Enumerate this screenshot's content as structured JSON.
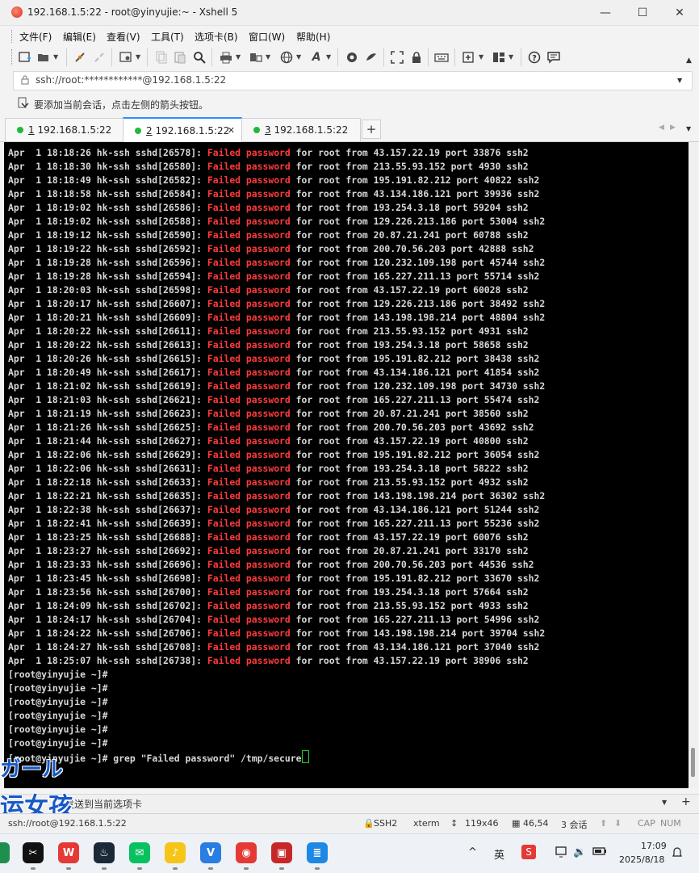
{
  "window": {
    "title": "192.168.1.5:22 - root@yinyujie:~ - Xshell 5",
    "minimize_glyph": "—",
    "maximize_glyph": "☐",
    "close_glyph": "✕"
  },
  "menu": [
    "文件(F)",
    "编辑(E)",
    "查看(V)",
    "工具(T)",
    "选项卡(B)",
    "窗口(W)",
    "帮助(H)"
  ],
  "address": {
    "value": "ssh://root:************@192.168.1.5:22"
  },
  "hint": {
    "text": "要添加当前会话，点击左侧的箭头按钮。"
  },
  "tabs": [
    {
      "num": "1",
      "label": " 192.168.1.5:22"
    },
    {
      "num": "2",
      "label": " 192.168.1.5:22"
    },
    {
      "num": "3",
      "label": " 192.168.1.5:22"
    }
  ],
  "tab_close_glyph": "✕",
  "tab_add_glyph": "+",
  "terminal": {
    "log": [
      {
        "prefix": "Apr  1 18:18:26 hk-ssh sshd[26578]: ",
        "failed": "Failed",
        "password": "password",
        "suffix": " for root from 43.157.22.19 port 33876 ssh2"
      },
      {
        "prefix": "Apr  1 18:18:30 hk-ssh sshd[26580]: ",
        "failed": "Failed",
        "password": "password",
        "suffix": " for root from 213.55.93.152 port 4930 ssh2"
      },
      {
        "prefix": "Apr  1 18:18:49 hk-ssh sshd[26582]: ",
        "failed": "Failed",
        "password": "password",
        "suffix": " for root from 195.191.82.212 port 40822 ssh2"
      },
      {
        "prefix": "Apr  1 18:18:58 hk-ssh sshd[26584]: ",
        "failed": "Failed",
        "password": "password",
        "suffix": " for root from 43.134.186.121 port 39936 ssh2"
      },
      {
        "prefix": "Apr  1 18:19:02 hk-ssh sshd[26586]: ",
        "failed": "Failed",
        "password": "password",
        "suffix": " for root from 193.254.3.18 port 59204 ssh2"
      },
      {
        "prefix": "Apr  1 18:19:02 hk-ssh sshd[26588]: ",
        "failed": "Failed",
        "password": "password",
        "suffix": " for root from 129.226.213.186 port 53004 ssh2"
      },
      {
        "prefix": "Apr  1 18:19:12 hk-ssh sshd[26590]: ",
        "failed": "Failed",
        "password": "password",
        "suffix": " for root from 20.87.21.241 port 60788 ssh2"
      },
      {
        "prefix": "Apr  1 18:19:22 hk-ssh sshd[26592]: ",
        "failed": "Failed",
        "password": "password",
        "suffix": " for root from 200.70.56.203 port 42888 ssh2"
      },
      {
        "prefix": "Apr  1 18:19:28 hk-ssh sshd[26596]: ",
        "failed": "Failed",
        "password": "password",
        "suffix": " for root from 120.232.109.198 port 45744 ssh2"
      },
      {
        "prefix": "Apr  1 18:19:28 hk-ssh sshd[26594]: ",
        "failed": "Failed",
        "password": "password",
        "suffix": " for root from 165.227.211.13 port 55714 ssh2"
      },
      {
        "prefix": "Apr  1 18:20:03 hk-ssh sshd[26598]: ",
        "failed": "Failed",
        "password": "password",
        "suffix": " for root from 43.157.22.19 port 60028 ssh2"
      },
      {
        "prefix": "Apr  1 18:20:17 hk-ssh sshd[26607]: ",
        "failed": "Failed",
        "password": "password",
        "suffix": " for root from 129.226.213.186 port 38492 ssh2"
      },
      {
        "prefix": "Apr  1 18:20:21 hk-ssh sshd[26609]: ",
        "failed": "Failed",
        "password": "password",
        "suffix": " for root from 143.198.198.214 port 48804 ssh2"
      },
      {
        "prefix": "Apr  1 18:20:22 hk-ssh sshd[26611]: ",
        "failed": "Failed",
        "password": "password",
        "suffix": " for root from 213.55.93.152 port 4931 ssh2"
      },
      {
        "prefix": "Apr  1 18:20:22 hk-ssh sshd[26613]: ",
        "failed": "Failed",
        "password": "password",
        "suffix": " for root from 193.254.3.18 port 58658 ssh2"
      },
      {
        "prefix": "Apr  1 18:20:26 hk-ssh sshd[26615]: ",
        "failed": "Failed",
        "password": "password",
        "suffix": " for root from 195.191.82.212 port 38438 ssh2"
      },
      {
        "prefix": "Apr  1 18:20:49 hk-ssh sshd[26617]: ",
        "failed": "Failed",
        "password": "password",
        "suffix": " for root from 43.134.186.121 port 41854 ssh2"
      },
      {
        "prefix": "Apr  1 18:21:02 hk-ssh sshd[26619]: ",
        "failed": "Failed",
        "password": "password",
        "suffix": " for root from 120.232.109.198 port 34730 ssh2"
      },
      {
        "prefix": "Apr  1 18:21:03 hk-ssh sshd[26621]: ",
        "failed": "Failed",
        "password": "password",
        "suffix": " for root from 165.227.211.13 port 55474 ssh2"
      },
      {
        "prefix": "Apr  1 18:21:19 hk-ssh sshd[26623]: ",
        "failed": "Failed",
        "password": "password",
        "suffix": " for root from 20.87.21.241 port 38560 ssh2"
      },
      {
        "prefix": "Apr  1 18:21:26 hk-ssh sshd[26625]: ",
        "failed": "Failed",
        "password": "password",
        "suffix": " for root from 200.70.56.203 port 43692 ssh2"
      },
      {
        "prefix": "Apr  1 18:21:44 hk-ssh sshd[26627]: ",
        "failed": "Failed",
        "password": "password",
        "suffix": " for root from 43.157.22.19 port 40800 ssh2"
      },
      {
        "prefix": "Apr  1 18:22:06 hk-ssh sshd[26629]: ",
        "failed": "Failed",
        "password": "password",
        "suffix": " for root from 195.191.82.212 port 36054 ssh2"
      },
      {
        "prefix": "Apr  1 18:22:06 hk-ssh sshd[26631]: ",
        "failed": "Failed",
        "password": "password",
        "suffix": " for root from 193.254.3.18 port 58222 ssh2"
      },
      {
        "prefix": "Apr  1 18:22:18 hk-ssh sshd[26633]: ",
        "failed": "Failed",
        "password": "password",
        "suffix": " for root from 213.55.93.152 port 4932 ssh2"
      },
      {
        "prefix": "Apr  1 18:22:21 hk-ssh sshd[26635]: ",
        "failed": "Failed",
        "password": "password",
        "suffix": " for root from 143.198.198.214 port 36302 ssh2"
      },
      {
        "prefix": "Apr  1 18:22:38 hk-ssh sshd[26637]: ",
        "failed": "Failed",
        "password": "password",
        "suffix": " for root from 43.134.186.121 port 51244 ssh2"
      },
      {
        "prefix": "Apr  1 18:22:41 hk-ssh sshd[26639]: ",
        "failed": "Failed",
        "password": "password",
        "suffix": " for root from 165.227.211.13 port 55236 ssh2"
      },
      {
        "prefix": "Apr  1 18:23:25 hk-ssh sshd[26688]: ",
        "failed": "Failed",
        "password": "password",
        "suffix": " for root from 43.157.22.19 port 60076 ssh2"
      },
      {
        "prefix": "Apr  1 18:23:27 hk-ssh sshd[26692]: ",
        "failed": "Failed",
        "password": "password",
        "suffix": " for root from 20.87.21.241 port 33170 ssh2"
      },
      {
        "prefix": "Apr  1 18:23:33 hk-ssh sshd[26696]: ",
        "failed": "Failed",
        "password": "password",
        "suffix": " for root from 200.70.56.203 port 44536 ssh2"
      },
      {
        "prefix": "Apr  1 18:23:45 hk-ssh sshd[26698]: ",
        "failed": "Failed",
        "password": "password",
        "suffix": " for root from 195.191.82.212 port 33670 ssh2"
      },
      {
        "prefix": "Apr  1 18:23:56 hk-ssh sshd[26700]: ",
        "failed": "Failed",
        "password": "password",
        "suffix": " for root from 193.254.3.18 port 57664 ssh2"
      },
      {
        "prefix": "Apr  1 18:24:09 hk-ssh sshd[26702]: ",
        "failed": "Failed",
        "password": "password",
        "suffix": " for root from 213.55.93.152 port 4933 ssh2"
      },
      {
        "prefix": "Apr  1 18:24:17 hk-ssh sshd[26704]: ",
        "failed": "Failed",
        "password": "password",
        "suffix": " for root from 165.227.211.13 port 54996 ssh2"
      },
      {
        "prefix": "Apr  1 18:24:22 hk-ssh sshd[26706]: ",
        "failed": "Failed",
        "password": "password",
        "suffix": " for root from 143.198.198.214 port 39704 ssh2"
      },
      {
        "prefix": "Apr  1 18:24:27 hk-ssh sshd[26708]: ",
        "failed": "Failed",
        "password": "password",
        "suffix": " for root from 43.134.186.121 port 37040 ssh2"
      },
      {
        "prefix": "Apr  1 18:25:07 hk-ssh sshd[26738]: ",
        "failed": "Failed",
        "password": "password",
        "suffix": " for root from 43.157.22.19 port 38906 ssh2"
      }
    ],
    "prompt": "[root@yinyujie ~]#",
    "empty_prompt_count": 6,
    "command": " grep \"Failed password\" /tmp/secure"
  },
  "compose_bar": {
    "text": "发送到当前选项卡"
  },
  "status": {
    "connection": "ssh://root@192.168.1.5:22",
    "protocol": "SSH2",
    "terminal_type": "xterm",
    "size": "119x46",
    "cursor_pos": "46,54",
    "sessions": "3 会话",
    "caps": "CAP",
    "num": "NUM"
  },
  "overlay": {
    "text_top": "ガール",
    "text_bottom": "运女孩"
  },
  "taskbar": {
    "apps": [
      {
        "name": "capcut-icon",
        "glyph": "✂",
        "color": "#111111"
      },
      {
        "name": "wps-icon",
        "glyph": "W",
        "color": "#e53935"
      },
      {
        "name": "steam-icon",
        "glyph": "♨",
        "color": "#1b2838"
      },
      {
        "name": "wechat-icon",
        "glyph": "✉",
        "color": "#07c160"
      },
      {
        "name": "music-icon",
        "glyph": "♪",
        "color": "#f5c518"
      },
      {
        "name": "vscode-icon",
        "glyph": "V",
        "color": "#2a7de1"
      },
      {
        "name": "xshell-icon",
        "glyph": "◉",
        "color": "#e53935"
      },
      {
        "name": "game-icon",
        "glyph": "▣",
        "color": "#c62828"
      },
      {
        "name": "notepad-icon",
        "glyph": "≣",
        "color": "#1e88e5"
      }
    ],
    "ime_label": "英",
    "time": "17:09",
    "date": "2025/8/18"
  }
}
